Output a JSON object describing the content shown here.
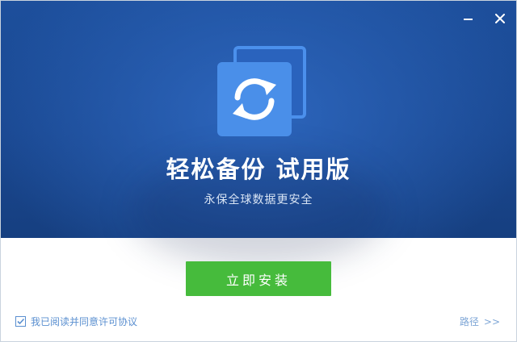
{
  "window": {
    "minimize_icon": "minimize-icon",
    "close_icon": "close-icon"
  },
  "hero": {
    "logo_icon": "sync-backup-icon",
    "title": "轻松备份  试用版",
    "subtitle": "永保全球数据更安全"
  },
  "actions": {
    "install_label": "立即安装"
  },
  "footer": {
    "agree_checked": true,
    "agree_label": "我已阅读并同意许可协议",
    "path_label": "路径",
    "path_arrow": ">>"
  },
  "colors": {
    "hero_bg": "#1a4891",
    "logo_blue": "#4a8fe9",
    "install_green": "#46bb3c",
    "link_blue": "#5a8fd0"
  }
}
